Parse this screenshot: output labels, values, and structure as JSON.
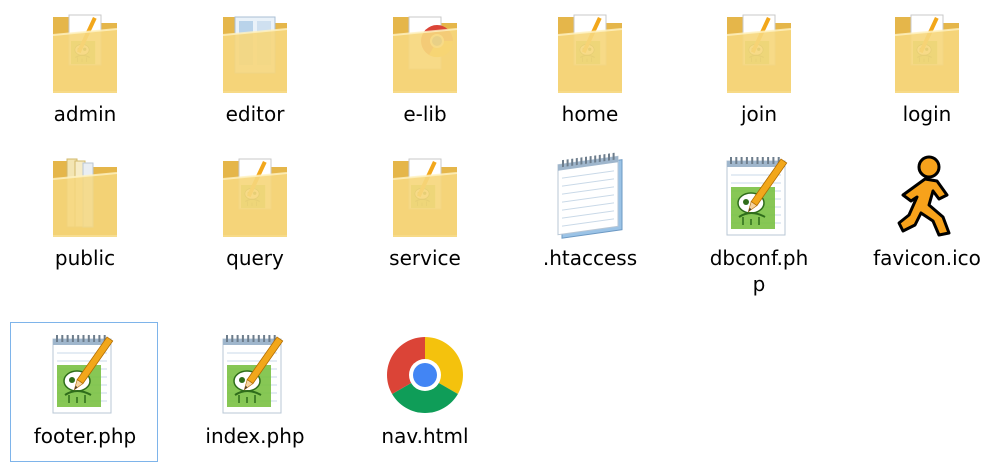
{
  "files": [
    {
      "name": "admin",
      "icon": "folder-icon",
      "kind": "folder-notepad"
    },
    {
      "name": "editor",
      "icon": "folder-icon",
      "kind": "folder-editor"
    },
    {
      "name": "e-lib",
      "icon": "folder-icon",
      "kind": "folder-chrome"
    },
    {
      "name": "home",
      "icon": "folder-icon",
      "kind": "folder-notepad"
    },
    {
      "name": "join",
      "icon": "folder-icon",
      "kind": "folder-notepad"
    },
    {
      "name": "login",
      "icon": "folder-icon",
      "kind": "folder-notepad"
    },
    {
      "name": "public",
      "icon": "folder-icon",
      "kind": "folder-plain"
    },
    {
      "name": "query",
      "icon": "folder-icon",
      "kind": "folder-notepad"
    },
    {
      "name": "service",
      "icon": "folder-icon",
      "kind": "folder-notepad"
    },
    {
      "name": ".htaccess",
      "icon": "notepad-icon",
      "kind": "notepad"
    },
    {
      "name": "dbconf.php",
      "icon": "notepadpp-file-icon",
      "kind": "notepadpp"
    },
    {
      "name": "favicon.ico",
      "icon": "aim-runner-icon",
      "kind": "aim"
    },
    {
      "name": "footer.php",
      "icon": "notepadpp-file-icon",
      "kind": "notepadpp",
      "selected": true
    },
    {
      "name": "index.php",
      "icon": "notepadpp-file-icon",
      "kind": "notepadpp"
    },
    {
      "name": "nav.html",
      "icon": "chrome-icon",
      "kind": "chrome"
    }
  ],
  "colors": {
    "folder": "#f6d77d",
    "folder_dark": "#e5b64a",
    "selection_border": "#7eb4ea",
    "notepadpp_green": "#7ac143",
    "chrome_red": "#db4437",
    "chrome_yellow": "#f4c20d",
    "chrome_green": "#0f9d58",
    "chrome_blue": "#4285f4",
    "aim_orange": "#f7a21b"
  }
}
